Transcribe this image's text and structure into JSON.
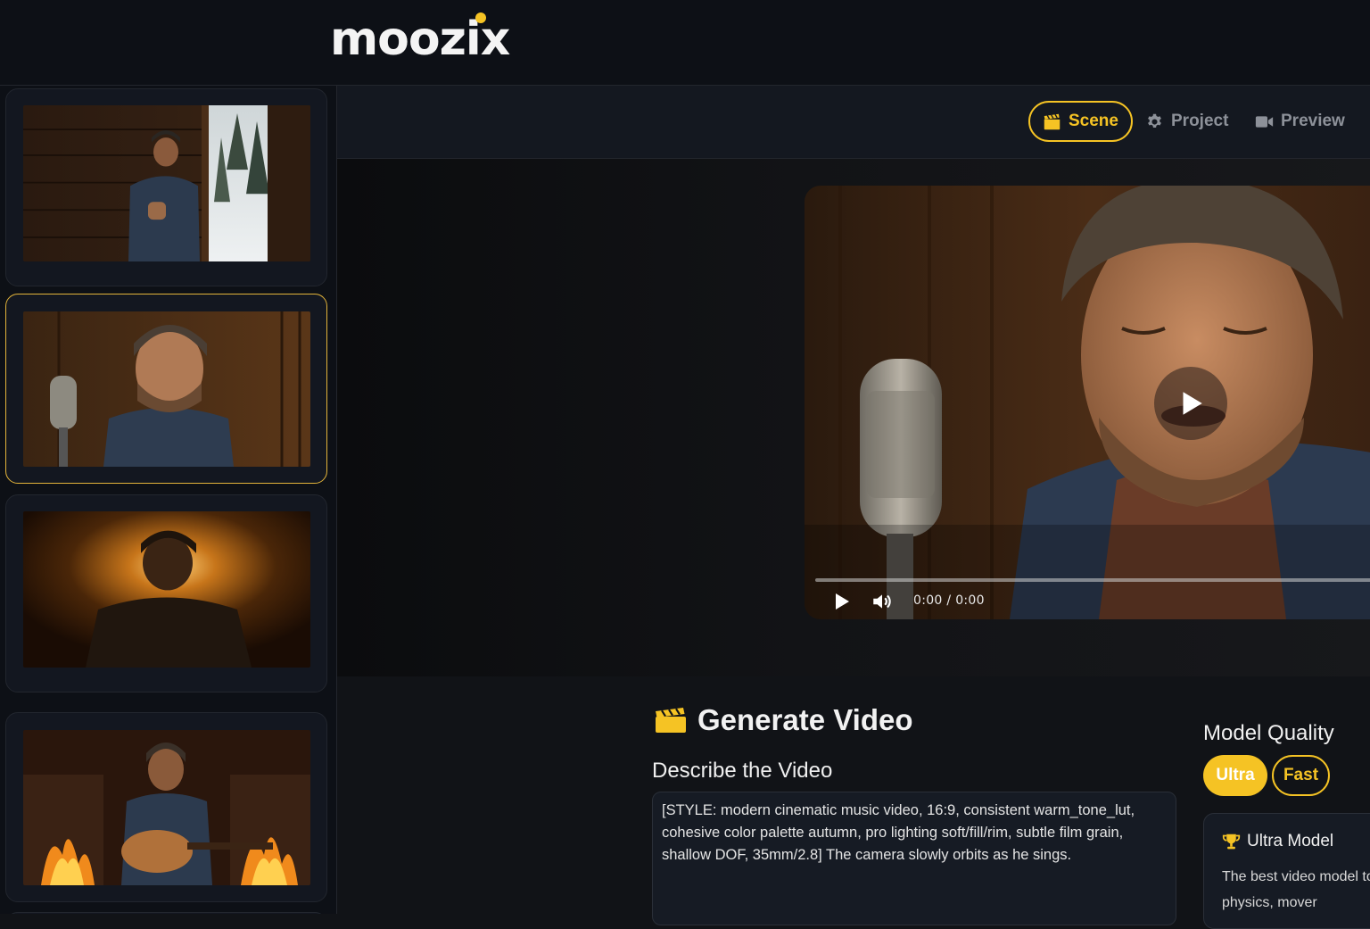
{
  "app": {
    "logo": "moozix"
  },
  "tabs": [
    {
      "label": "Scene",
      "icon": "clapperboard-icon",
      "active": true
    },
    {
      "label": "Project",
      "icon": "gear-icon",
      "active": false
    },
    {
      "label": "Preview",
      "icon": "video-camera-icon",
      "active": false
    }
  ],
  "scenes": [
    {
      "description": "man in denim jacket at cabin doorway, snowy pines",
      "selected": false
    },
    {
      "description": "man singing with eyes closed at studio microphone",
      "selected": true
    },
    {
      "description": "man backlit by warm glow, head bowed",
      "selected": false
    },
    {
      "description": "man playing acoustic guitar by fireplaces",
      "selected": false
    }
  ],
  "player": {
    "time_current": "0:00",
    "time_separator": "/",
    "time_total": "0:00",
    "progress": 0
  },
  "generate": {
    "title": "Generate Video",
    "describe_label": "Describe the Video",
    "prompt": "[STYLE: modern cinematic music video, 16:9, consistent warm_tone_lut, cohesive color palette autumn, pro lighting soft/fill/rim, subtle film grain, shallow DOF, 35mm/2.8] The camera slowly orbits as he sings."
  },
  "model_quality": {
    "label": "Model Quality",
    "options": [
      "Ultra",
      "Fast"
    ],
    "selected": "Ultra",
    "card_title": "Ultra Model",
    "card_text": "The best video model to sense of physics, mover"
  },
  "colors": {
    "accent": "#f5c324",
    "background": "#111317",
    "panel": "#161b24"
  }
}
